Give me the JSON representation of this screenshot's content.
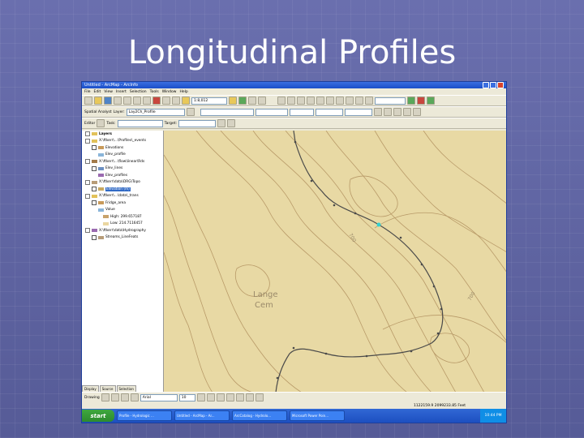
{
  "slide": {
    "title": "Longitudinal Profiles"
  },
  "app": {
    "window_title": "Untitled - ArcMap - ArcInfo",
    "menus": [
      "File",
      "Edit",
      "View",
      "Insert",
      "Selection",
      "Tools",
      "Window",
      "Help"
    ],
    "scale": "1:8,012",
    "layer_combo": "Lay2Ch_Profile",
    "task_label": "Task:",
    "target_label": "Target:",
    "editor_label": "Editor",
    "spatial_analyst_label": "Spatial Analyst"
  },
  "toc": {
    "root": "Layers",
    "items": [
      {
        "label": "X:\\ftkerr\\...\\Profiles\\_events",
        "level": 1
      },
      {
        "label": "Elevations",
        "level": 2
      },
      {
        "label": "Elev_profile",
        "level": 3
      },
      {
        "label": "X:\\ftkerr\\...\\flow\\linear\\Rds",
        "level": 1
      },
      {
        "label": "Elev_lines",
        "level": 2
      },
      {
        "label": "Elev_profiles",
        "level": 3
      },
      {
        "label": "X:\\ftkerr\\data\\DRG\\Topo",
        "level": 1
      },
      {
        "label": "Elevation (m)",
        "level": 2,
        "selected": true
      },
      {
        "label": "X:\\ftkerr\\...\\data\\_trans",
        "level": 1
      },
      {
        "label": "Fridge_area",
        "level": 2
      },
      {
        "label": "Value",
        "level": 3
      },
      {
        "label": "High: 299.657187",
        "level": 4
      },
      {
        "label": "Low: 214.7116457",
        "level": 4
      },
      {
        "label": "X:\\ftkerr\\data\\Hydrography",
        "level": 1
      },
      {
        "label": "Streams_LineFeats",
        "level": 2
      }
    ],
    "tabs": [
      "Display",
      "Source",
      "Selection"
    ]
  },
  "map": {
    "labels": [
      {
        "text": "Lange"
      },
      {
        "text": "Cem"
      },
      {
        "text": "700"
      },
      {
        "text": "700"
      }
    ],
    "colors": {
      "background": "#e8d9a4",
      "contour": "#b89a68",
      "profile": "#4a4a4a",
      "highlight": "#34d0d0"
    }
  },
  "drawing_toolbar": {
    "label": "Drawing",
    "font": "Arial",
    "size": "10"
  },
  "status": {
    "coords": "1122159.9 2099233.85 Feet"
  },
  "taskbar": {
    "start": "start",
    "tasks": [
      "Profile - Hydrologic ...",
      "Untitled - ArcMap - Ar...",
      "ArcCatalog - Hydrolo...",
      "Microsoft Power Poin..."
    ],
    "clock": "10:44 PM"
  }
}
